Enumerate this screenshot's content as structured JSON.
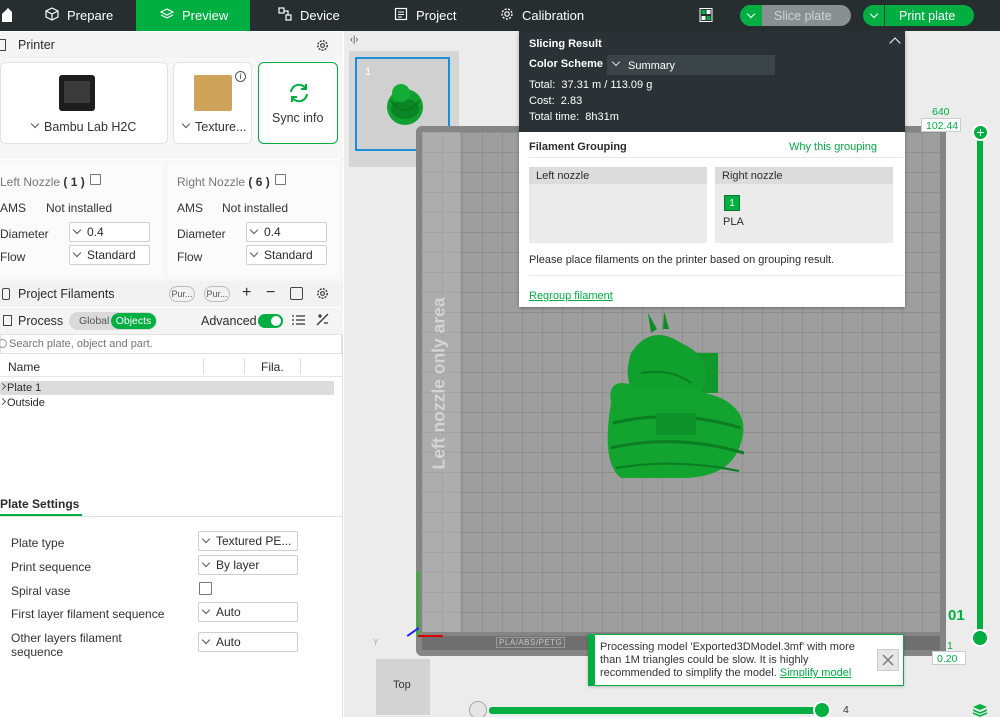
{
  "topbar": {
    "tabs": [
      {
        "label": "Prepare",
        "icon": "cube-icon"
      },
      {
        "label": "Preview",
        "icon": "layers-icon",
        "active": true
      },
      {
        "label": "Device",
        "icon": "device-icon"
      },
      {
        "label": "Project",
        "icon": "project-icon"
      },
      {
        "label": "Calibration",
        "icon": "gear-icon"
      }
    ],
    "slice_label": "Slice plate",
    "print_label": "Print plate"
  },
  "printer": {
    "header": "Printer",
    "model": "Bambu Lab H2C",
    "plate_short": "Texture...",
    "sync_label": "Sync info",
    "left_nozzle": {
      "title": "Left Nozzle",
      "count": "( 1 )",
      "ams_label": "AMS",
      "ams_value": "Not installed",
      "diameter_label": "Diameter",
      "diameter": "0.4",
      "flow_label": "Flow",
      "flow": "Standard"
    },
    "right_nozzle": {
      "title": "Right Nozzle",
      "count": "( 6 )",
      "ams_label": "AMS",
      "ams_value": "Not installed",
      "diameter_label": "Diameter",
      "diameter": "0.4",
      "flow_label": "Flow",
      "flow": "Standard"
    }
  },
  "filaments": {
    "header": "Project Filaments",
    "pill1": "Pur...",
    "pill2": "Pur..."
  },
  "process": {
    "header": "Process",
    "global_label": "Global",
    "objects_label": "Objects",
    "advanced_label": "Advanced",
    "search_placeholder": "Search plate, object and part.",
    "col_name": "Name",
    "col_fila": "Fila.",
    "rows": [
      "Plate 1",
      "Outside"
    ]
  },
  "plate_settings": {
    "header": "Plate Settings",
    "rows": [
      {
        "label": "Plate type",
        "value": "Textured PE..."
      },
      {
        "label": "Print sequence",
        "value": "By layer"
      },
      {
        "label": "Spiral vase",
        "value": ""
      },
      {
        "label": "First layer filament sequence",
        "value": "Auto"
      },
      {
        "label": "Other layers filament sequence",
        "value": "Auto"
      }
    ]
  },
  "viewport": {
    "thumb_number": "1",
    "left_nozzle_area": "Left nozzle only area",
    "bed_label": "PLA/ABS/PETG",
    "top_button": "Top",
    "axis_y": "Y",
    "layer_top": "640",
    "layer_top_height": "102.44",
    "layer_bottom": "1",
    "layer_bottom_height": "0.20",
    "layer_current": "01",
    "horizontal_value": "4"
  },
  "slicing": {
    "title": "Slicing Result",
    "color_scheme_label": "Color Scheme",
    "color_scheme_value": "Summary",
    "total": "Total:  37.31 m / 113.09 g",
    "cost": "Cost:  2.83",
    "time": "Total time:  8h31m",
    "grouping_title": "Filament Grouping",
    "why_link": "Why this grouping",
    "left_nozzle": "Left nozzle",
    "right_nozzle": "Right nozzle",
    "slot_number": "1",
    "slot_material": "PLA",
    "hint": "Please place filaments on the printer based on grouping result.",
    "regroup": "Regroup filament"
  },
  "notification": {
    "message": "Processing model 'Exported3DModel.3mf' with more than 1M triangles could be slow. It is highly recommended to simplify the model.",
    "link": "Simplify model"
  },
  "colors": {
    "accent": "#00ae42",
    "topbar": "#262e30",
    "bed": "#9e9e9e",
    "model": "#0e9a2a"
  }
}
